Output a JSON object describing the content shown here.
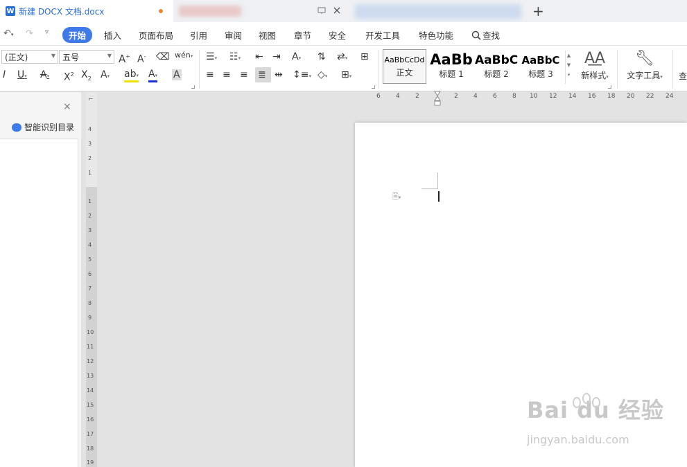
{
  "tabbar": {
    "active_tab_title": "新建 DOCX 文档.docx",
    "active_tab_icon": "W",
    "new_tab": "+"
  },
  "menubar": {
    "items": [
      "开始",
      "插入",
      "页面布局",
      "引用",
      "审阅",
      "视图",
      "章节",
      "安全",
      "开发工具",
      "特色功能"
    ],
    "search_label": "查找",
    "active_color": "#3e7be9"
  },
  "ribbon": {
    "font_name": "(正文)",
    "font_size": "五号",
    "styles": [
      {
        "sample": "AaBbCcDd",
        "label": "正文"
      },
      {
        "sample": "AaBb",
        "label": "标题 1"
      },
      {
        "sample": "AaBbC",
        "label": "标题 2"
      },
      {
        "sample": "AaBbC",
        "label": "标题 3"
      }
    ],
    "new_style": "新样式",
    "text_tools": "文字工具",
    "find_partial": "查"
  },
  "leftpanel": {
    "close": "×",
    "smart_toc": "智能识别目录"
  },
  "ruler": {
    "h_labels": [
      "6",
      "4",
      "2",
      "2",
      "4",
      "6",
      "8",
      "10",
      "12",
      "14",
      "16",
      "18",
      "20",
      "22",
      "24"
    ],
    "v_labels": [
      "4",
      "3",
      "2",
      "1",
      "1",
      "2",
      "3",
      "4",
      "5",
      "6",
      "7",
      "8",
      "9",
      "10",
      "11",
      "12",
      "13",
      "14",
      "15",
      "16",
      "17",
      "18",
      "19"
    ]
  },
  "watermark": {
    "brand": "Bai du 经验",
    "url": "jingyan.baidu.com"
  }
}
